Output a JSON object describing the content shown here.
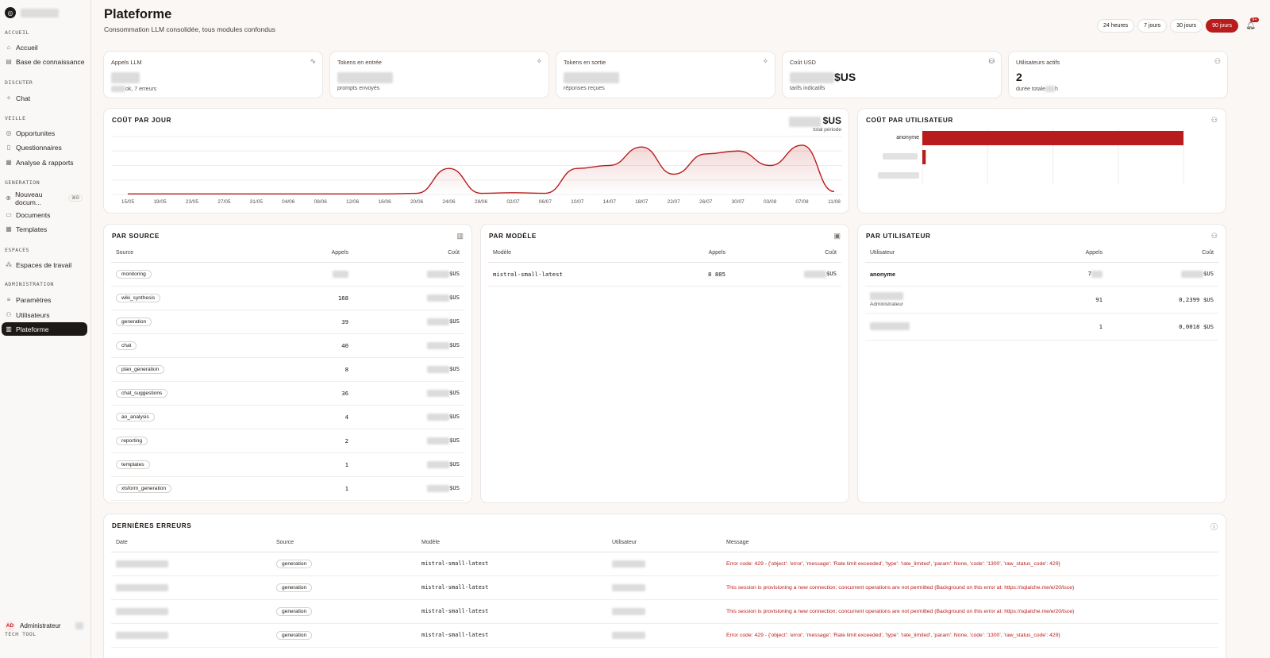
{
  "sidebar": {
    "sections": [
      {
        "label": "ACCUEIL",
        "items": [
          {
            "label": "Accueil",
            "icon": "home-icon",
            "active": false
          },
          {
            "label": "Base de connaissance",
            "icon": "book-icon",
            "active": false
          }
        ]
      },
      {
        "label": "DISCUTER",
        "items": [
          {
            "label": "Chat",
            "icon": "sparkle-icon",
            "active": false
          }
        ]
      },
      {
        "label": "VEILLE",
        "items": [
          {
            "label": "Opportunites",
            "icon": "target-icon",
            "active": false
          },
          {
            "label": "Questionnaires",
            "icon": "file-icon",
            "active": false
          },
          {
            "label": "Analyse & rapports",
            "icon": "report-icon",
            "active": false
          }
        ]
      },
      {
        "label": "GENERATION",
        "items": [
          {
            "label": "Nouveau docum...",
            "icon": "plus-doc-icon",
            "active": false,
            "shortcut": "⌘B"
          },
          {
            "label": "Documents",
            "icon": "docs-icon",
            "active": false
          },
          {
            "label": "Templates",
            "icon": "template-icon",
            "active": false
          }
        ]
      },
      {
        "label": "ESPACES",
        "items": [
          {
            "label": "Espaces de travail",
            "icon": "workspace-icon",
            "active": false
          }
        ]
      },
      {
        "label": "ADMINISTRATION",
        "items": [
          {
            "label": "Paramètres",
            "icon": "sliders-icon",
            "active": false
          },
          {
            "label": "Utilisateurs",
            "icon": "users-icon",
            "active": false
          },
          {
            "label": "Plateforme",
            "icon": "chart-icon",
            "active": true
          }
        ]
      }
    ],
    "user": {
      "initials": "AD",
      "name": "Administrateur"
    },
    "footer": "TECH TOOL"
  },
  "header": {
    "title": "Plateforme",
    "subtitle": "Consommation LLM consolidée, tous modules confondus",
    "ranges": [
      "24 heures",
      "7 jours",
      "30 jours",
      "90 jours"
    ],
    "selected_range": "90 jours",
    "notif_count": "9+"
  },
  "kpis": [
    {
      "label": "Appels LLM",
      "icon": "activity-icon",
      "value": "",
      "sub": "ok, 7 erreurs"
    },
    {
      "label": "Tokens en entrée",
      "icon": "sparkle-icon",
      "value": "",
      "sub": "prompts envoyés"
    },
    {
      "label": "Tokens en sortie",
      "icon": "sparkle-icon",
      "value": "",
      "sub": "réponses reçues"
    },
    {
      "label": "Coût USD",
      "icon": "coins-icon",
      "value": "$US",
      "sub": "tarifs indicatifs"
    },
    {
      "label": "Utilisateurs actifs",
      "icon": "users-icon",
      "value": "2",
      "sub": "durée totale",
      "sub_suffix": "h"
    }
  ],
  "cost_per_day": {
    "title": "COÛT PAR JOUR",
    "total_unit": "$US",
    "total_label": "total période"
  },
  "chart_data": {
    "type": "area",
    "title": "COÛT PAR JOUR",
    "x": [
      "15/05",
      "19/05",
      "23/05",
      "27/05",
      "31/05",
      "04/06",
      "08/06",
      "12/06",
      "16/06",
      "20/06",
      "24/06",
      "28/06",
      "02/07",
      "06/07",
      "10/07",
      "14/07",
      "18/07",
      "22/07",
      "26/07",
      "30/07",
      "03/08",
      "07/08",
      "11/08"
    ],
    "series": [
      {
        "values": [
          0.01,
          0.01,
          0.01,
          0.01,
          0.01,
          0.01,
          0.01,
          0.01,
          0.01,
          0.02,
          0.45,
          0.02,
          0.03,
          0.02,
          0.45,
          0.5,
          0.82,
          0.35,
          0.7,
          0.75,
          0.5,
          0.85,
          0.05
        ]
      }
    ],
    "color": "#b91c1c",
    "grid": true
  },
  "cost_per_user": {
    "title": "COÛT PAR UTILISATEUR",
    "bars": [
      {
        "label": "anonyme",
        "value": 1.0
      },
      {
        "label": "",
        "value": 0.013
      },
      {
        "label": "",
        "value": 0.0
      }
    ]
  },
  "by_source": {
    "title": "PAR SOURCE",
    "columns": [
      "Source",
      "Appels",
      "Coût"
    ],
    "rows": [
      {
        "source": "monitoring",
        "calls": "",
        "cost": "$US"
      },
      {
        "source": "wiki_synthesis",
        "calls": "168",
        "cost": "$US"
      },
      {
        "source": "generation",
        "calls": "39",
        "cost": "$US"
      },
      {
        "source": "chat",
        "calls": "40",
        "cost": "$US"
      },
      {
        "source": "plan_generation",
        "calls": "8",
        "cost": "$US"
      },
      {
        "source": "chat_suggestions",
        "calls": "36",
        "cost": "$US"
      },
      {
        "source": "ao_analysis",
        "calls": "4",
        "cost": "$US"
      },
      {
        "source": "reporting",
        "calls": "2",
        "cost": "$US"
      },
      {
        "source": "templates",
        "calls": "1",
        "cost": "$US"
      },
      {
        "source": "xlsform_generation",
        "calls": "1",
        "cost": "$US"
      }
    ]
  },
  "by_model": {
    "title": "PAR MODÈLE",
    "columns": [
      "Modèle",
      "Appels",
      "Coût"
    ],
    "rows": [
      {
        "model": "mistral-small-latest",
        "calls": "8 805",
        "cost": "$US"
      }
    ]
  },
  "by_user": {
    "title": "PAR UTILISATEUR",
    "columns": [
      "Utilisateur",
      "Appels",
      "Coût"
    ],
    "rows": [
      {
        "user": "anonyme",
        "role": "",
        "calls": "7",
        "cost": "$US"
      },
      {
        "user": "",
        "role": "Administrateur",
        "calls": "91",
        "cost": "0,2399 $US"
      },
      {
        "user": "",
        "role": "",
        "calls": "1",
        "cost": "0,0018 $US"
      }
    ]
  },
  "errors": {
    "title": "DERNIÈRES ERREURS",
    "columns": [
      "Date",
      "Source",
      "Modèle",
      "Utilisateur",
      "Message"
    ],
    "rows": [
      {
        "source": "generation",
        "model": "mistral-small-latest",
        "message": "Error code: 429 - {'object': 'error', 'message': 'Rate limit exceeded', 'type': 'rate_limited', 'param': None, 'code': '1300', 'raw_status_code': 429}"
      },
      {
        "source": "generation",
        "model": "mistral-small-latest",
        "message": "This session is provisioning a new connection; concurrent operations are not permitted (Background on this error at: https://sqlalche.me/e/20/isce)"
      },
      {
        "source": "generation",
        "model": "mistral-small-latest",
        "message": "This session is provisioning a new connection; concurrent operations are not permitted (Background on this error at: https://sqlalche.me/e/20/isce)"
      },
      {
        "source": "generation",
        "model": "mistral-small-latest",
        "message": "Error code: 429 - {'object': 'error', 'message': 'Rate limit exceeded', 'type': 'rate_limited', 'param': None, 'code': '1300', 'raw_status_code': 429}"
      }
    ]
  }
}
